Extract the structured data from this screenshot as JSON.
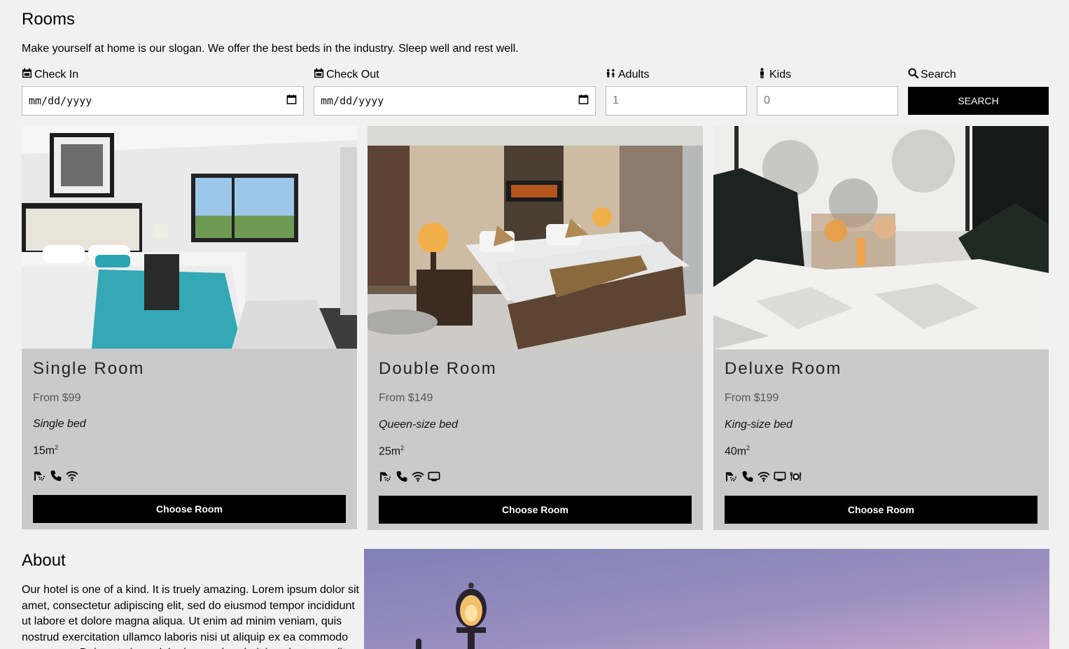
{
  "rooms": {
    "title": "Rooms",
    "slogan": "Make yourself at home is our slogan. We offer the best beds in the industry. Sleep well and rest well."
  },
  "search": {
    "check_in_label": "Check In",
    "check_out_label": "Check Out",
    "adults_label": "Adults",
    "kids_label": "Kids",
    "search_label": "Search",
    "check_in_value": "mm/dd/yyyy",
    "check_out_value": "mm/dd/yyyy",
    "adults_value": "1",
    "kids_value": "0",
    "button_label": "SEARCH",
    "icons": [
      "calendar-icon",
      "calendar-icon",
      "people-icon",
      "child-icon",
      "search-icon"
    ]
  },
  "room_cards": [
    {
      "title": "Single Room",
      "price": "From $99",
      "bed": "Single bed",
      "size": "15m",
      "size_unit_sup": "2",
      "amenities": [
        "shower-icon",
        "phone-icon",
        "wifi-icon"
      ],
      "button": "Choose Room"
    },
    {
      "title": "Double Room",
      "price": "From $149",
      "bed": "Queen-size bed",
      "size": "25m",
      "size_unit_sup": "2",
      "amenities": [
        "shower-icon",
        "phone-icon",
        "wifi-icon",
        "tv-icon"
      ],
      "button": "Choose Room"
    },
    {
      "title": "Deluxe Room",
      "price": "From $199",
      "bed": "King-size bed",
      "size": "40m",
      "size_unit_sup": "2",
      "amenities": [
        "shower-icon",
        "phone-icon",
        "wifi-icon",
        "tv-icon",
        "restaurant-icon"
      ],
      "button": "Choose Room"
    }
  ],
  "about": {
    "title": "About",
    "text": "Our hotel is one of a kind. It is truely amazing. Lorem ipsum dolor sit amet, consectetur adipiscing elit, sed do eiusmod tempor incididunt ut labore et dolore magna aliqua. Ut enim ad minim veniam, quis nostrud exercitation ullamco laboris nisi ut aliquip ex ea commodo consequat. Duis aute irure dolor in reprehenderit in voluptate velit"
  }
}
